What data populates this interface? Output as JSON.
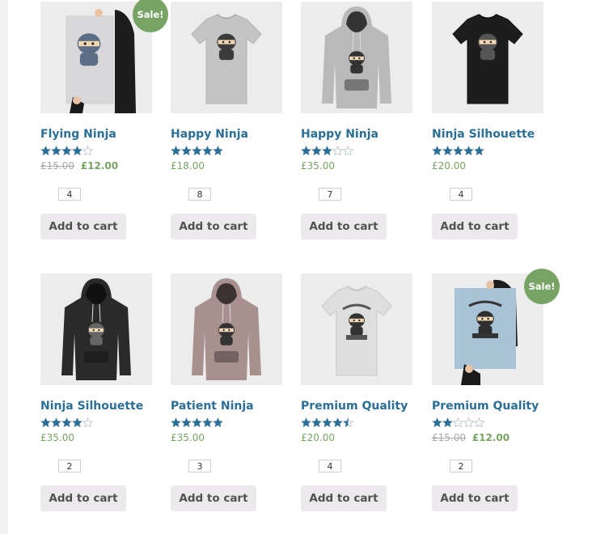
{
  "products": [
    {
      "title": "Flying Ninja",
      "rating": 4,
      "regular_price": "£15.00",
      "price": "£12.00",
      "on_sale": true,
      "sale_label": "Sale!",
      "qty": "4",
      "button_label": "Add to cart",
      "image": "poster-ninja"
    },
    {
      "title": "Happy Ninja",
      "rating": 5,
      "regular_price": "",
      "price": "£18.00",
      "on_sale": false,
      "sale_label": "",
      "qty": "8",
      "button_label": "Add to cart",
      "image": "tshirt-grey"
    },
    {
      "title": "Happy Ninja",
      "rating": 3,
      "regular_price": "",
      "price": "£35.00",
      "on_sale": false,
      "sale_label": "",
      "qty": "7",
      "button_label": "Add to cart",
      "image": "hoodie-grey"
    },
    {
      "title": "Ninja Silhouette",
      "rating": 5,
      "regular_price": "",
      "price": "£20.00",
      "on_sale": false,
      "sale_label": "",
      "qty": "4",
      "button_label": "Add to cart",
      "image": "tshirt-black"
    },
    {
      "title": "Ninja Silhouette",
      "rating": 4,
      "regular_price": "",
      "price": "£35.00",
      "on_sale": false,
      "sale_label": "",
      "qty": "2",
      "button_label": "Add to cart",
      "image": "hoodie-black"
    },
    {
      "title": "Patient Ninja",
      "rating": 5,
      "regular_price": "",
      "price": "£35.00",
      "on_sale": false,
      "sale_label": "",
      "qty": "3",
      "button_label": "Add to cart",
      "image": "hoodie-mauve"
    },
    {
      "title": "Premium Quality",
      "rating": 4.5,
      "regular_price": "",
      "price": "£20.00",
      "on_sale": false,
      "sale_label": "",
      "qty": "4",
      "button_label": "Add to cart",
      "image": "tshirt-white-logo"
    },
    {
      "title": "Premium Quality",
      "rating": 2,
      "regular_price": "£15.00",
      "price": "£12.00",
      "on_sale": true,
      "sale_label": "Sale!",
      "qty": "2",
      "button_label": "Add to cart",
      "image": "poster-woothemes"
    }
  ],
  "colors": {
    "accent": "#2b6e97",
    "price": "#77a464",
    "sale_badge": "#77a464",
    "button_bg": "#ebe9eb",
    "button_text": "#515151",
    "star": "#2b6e97"
  }
}
